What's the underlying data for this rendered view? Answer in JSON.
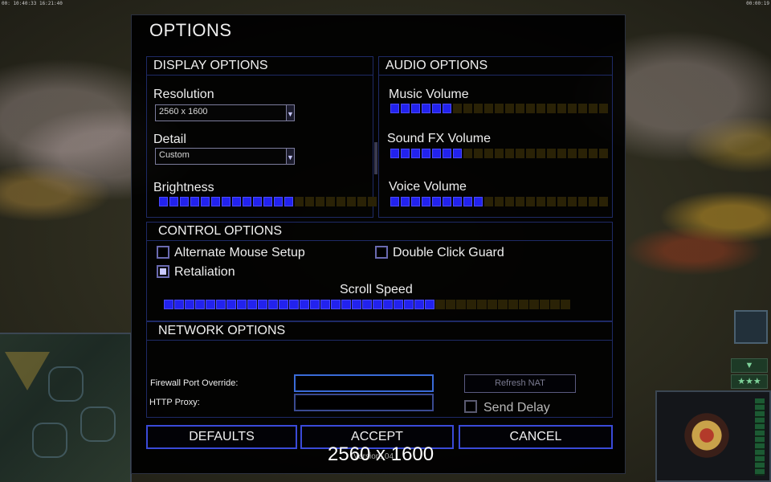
{
  "topbar": {
    "left": "00: 10:40:33  16:21:40",
    "right": "00:00:19"
  },
  "panel": {
    "title": "OPTIONS",
    "display": {
      "header": "DISPLAY OPTIONS",
      "resolution_label": "Resolution",
      "resolution_value": "2560 x 1600",
      "detail_label": "Detail",
      "detail_value": "Custom",
      "brightness_label": "Brightness",
      "brightness_level": 13,
      "brightness_total": 21
    },
    "audio": {
      "header": "AUDIO OPTIONS",
      "music_label": "Music Volume",
      "music_level": 6,
      "music_total": 21,
      "sfx_label": "Sound FX Volume",
      "sfx_level": 7,
      "sfx_total": 21,
      "voice_label": "Voice Volume",
      "voice_level": 9,
      "voice_total": 21
    },
    "control": {
      "header": "CONTROL OPTIONS",
      "alt_mouse_label": "Alternate Mouse Setup",
      "alt_mouse_checked": false,
      "double_click_label": "Double Click Guard",
      "double_click_checked": false,
      "retaliation_label": "Retaliation",
      "retaliation_checked": true,
      "scroll_label": "Scroll Speed",
      "scroll_level": 26,
      "scroll_total": 39
    },
    "network": {
      "header": "NETWORK OPTIONS",
      "firewall_label": "Firewall Port Override:",
      "firewall_value": "",
      "proxy_label": "HTTP Proxy:",
      "proxy_value": "",
      "refresh_nat_label": "Refresh NAT",
      "send_delay_label": "Send Delay",
      "send_delay_checked": false
    },
    "buttons": {
      "defaults": "DEFAULTS",
      "accept": "ACCEPT",
      "cancel": "CANCEL"
    },
    "overlay_text": "2560 x 1600",
    "version_text": "Version: 04"
  },
  "hud": {
    "stars": "★★★",
    "down_arrow": "▼"
  },
  "colors": {
    "slider_on": "#2222ee",
    "slider_off": "#2a2206",
    "border": "#1e2a66",
    "button_border": "#3a4ad8"
  }
}
